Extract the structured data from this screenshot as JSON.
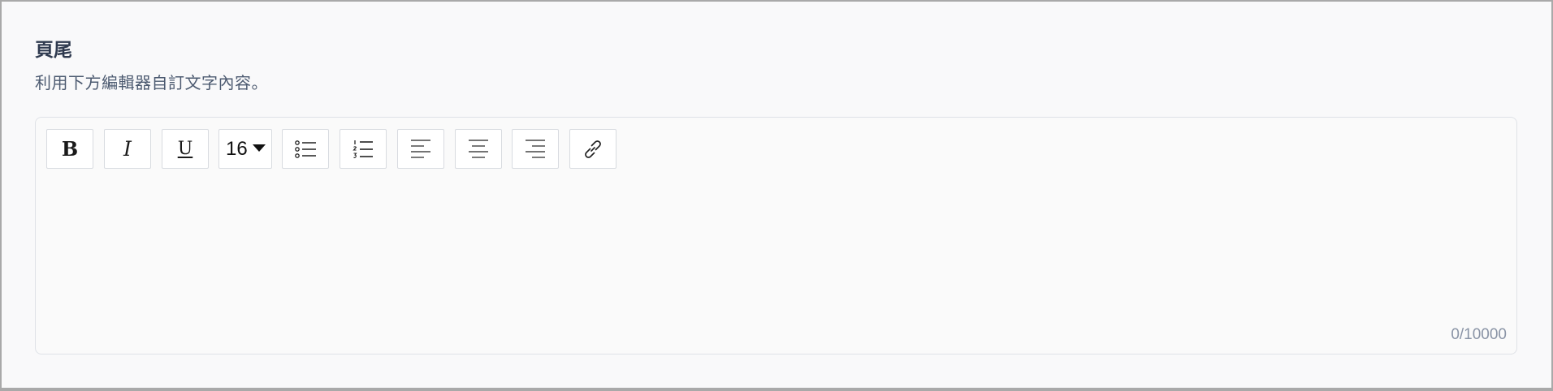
{
  "section": {
    "title": "頁尾",
    "description": "利用下方編輯器自訂文字內容。"
  },
  "editor": {
    "toolbar": {
      "bold_label": "B",
      "italic_label": "I",
      "underline_label": "U",
      "font_size_value": "16",
      "buttons": [
        {
          "name": "bold-button",
          "icon": "bold-icon"
        },
        {
          "name": "italic-button",
          "icon": "italic-icon"
        },
        {
          "name": "underline-button",
          "icon": "underline-icon"
        },
        {
          "name": "font-size-select",
          "icon": "chevron-down-icon"
        },
        {
          "name": "bulleted-list-button",
          "icon": "bulleted-list-icon"
        },
        {
          "name": "numbered-list-button",
          "icon": "numbered-list-icon"
        },
        {
          "name": "align-left-button",
          "icon": "align-left-icon"
        },
        {
          "name": "align-center-button",
          "icon": "align-center-icon"
        },
        {
          "name": "align-right-button",
          "icon": "align-right-icon"
        },
        {
          "name": "link-button",
          "icon": "link-icon"
        }
      ]
    },
    "content": "",
    "counter": "0/10000"
  },
  "colors": {
    "background": "#f9f9fa",
    "title": "#2f3a4f",
    "description": "#4c5a70",
    "border": "#dfe2e7",
    "counter": "#8a94a6"
  }
}
